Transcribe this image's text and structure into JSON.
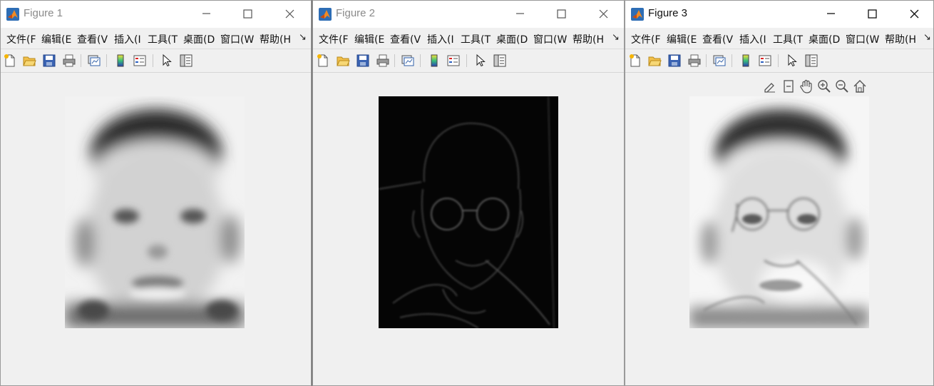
{
  "figures": [
    {
      "title": "Figure 1",
      "active": false,
      "image_name": "blurred-image",
      "menus": [
        "文件(F",
        "编辑(E",
        "查看(V",
        "插入(I",
        "工具(T",
        "桌面(D",
        "窗口(W",
        "帮助(H"
      ]
    },
    {
      "title": "Figure 2",
      "active": false,
      "image_name": "edge-image",
      "menus": [
        "文件(F",
        "编辑(E",
        "查看(V",
        "插入(I",
        "工具(T",
        "桌面(D",
        "窗口(W",
        "帮助(H"
      ]
    },
    {
      "title": "Figure 3",
      "active": true,
      "image_name": "sharpened-image",
      "menus": [
        "文件(F",
        "编辑(E",
        "查看(V",
        "插入(I",
        "工具(T",
        "桌面(D",
        "窗口(W",
        "帮助(H"
      ]
    }
  ],
  "window_controls": [
    "minimize-icon",
    "maximize-icon",
    "close-icon"
  ],
  "toolbar_icons": [
    "new-figure-icon",
    "open-file-icon",
    "save-icon",
    "print-icon",
    "link-plot-icon",
    "insert-colorbar-icon",
    "insert-legend-icon",
    "edit-plot-pointer-icon",
    "property-inspector-icon"
  ],
  "axes_toolbar_icons": [
    "brush-icon",
    "data-tips-icon",
    "pan-icon",
    "zoom-in-icon",
    "zoom-out-icon",
    "restore-view-icon"
  ],
  "colors": {
    "title_active": "#111111",
    "title_inactive": "#8a8a8a",
    "window_bg": "#f0f0f0"
  }
}
